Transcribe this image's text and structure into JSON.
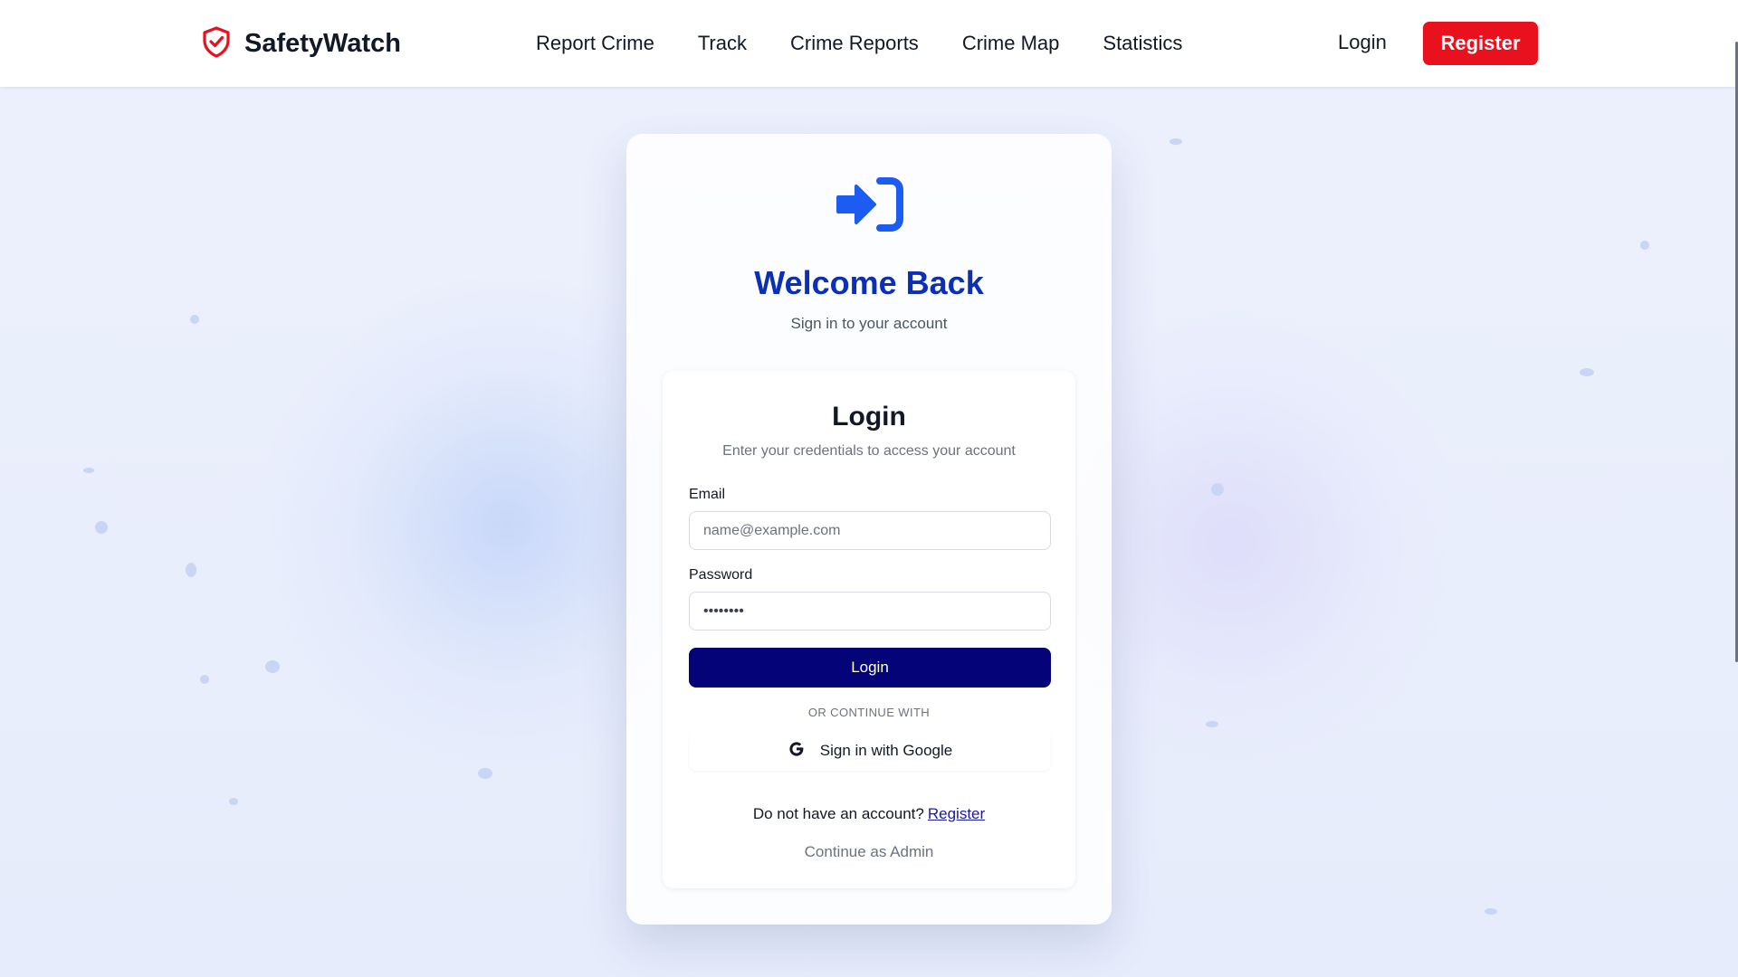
{
  "nav": {
    "brand": "SafetyWatch",
    "links": [
      "Report Crime",
      "Track",
      "Crime Reports",
      "Crime Map",
      "Statistics"
    ],
    "login_label": "Login",
    "register_label": "Register"
  },
  "hero": {
    "title": "Welcome Back",
    "subtitle": "Sign in to your account"
  },
  "form": {
    "title": "Login",
    "subtitle": "Enter your credentials to access your account",
    "email_label": "Email",
    "email_placeholder": "name@example.com",
    "password_label": "Password",
    "password_value": "••••••••",
    "submit_label": "Login",
    "divider": "OR CONTINUE WITH",
    "google_label": "Sign in with Google",
    "no_account_text": "Do not have an account?",
    "register_link": "Register",
    "admin_link": "Continue as Admin"
  },
  "colors": {
    "brand_red": "#e8111d",
    "heading_blue": "#0c2fb5",
    "primary_navy": "#040478",
    "icon_blue": "#1d5cf0"
  },
  "icons": {
    "brand": "shield-check-icon",
    "hero": "sign-in-icon",
    "google": "google-g-icon"
  }
}
